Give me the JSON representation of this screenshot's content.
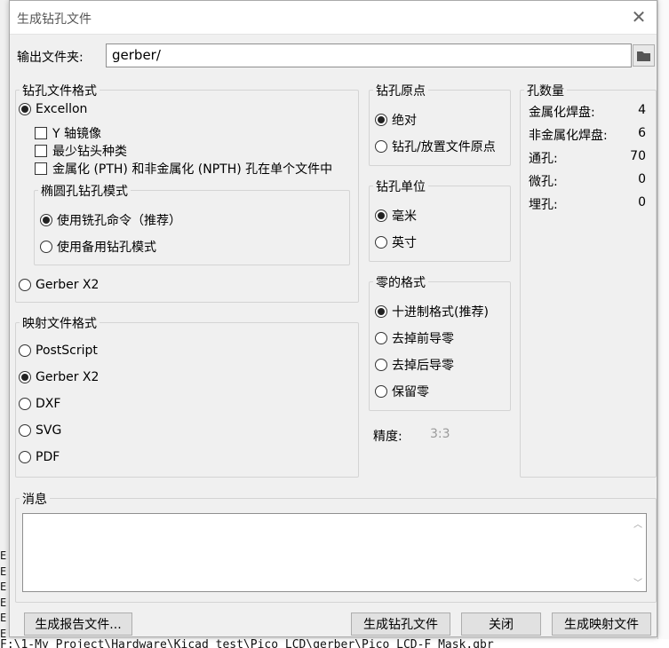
{
  "dialog": {
    "title": "生成钻孔文件",
    "output_folder_label": "输出文件夹:",
    "output_folder_value": "gerber/"
  },
  "drill_format": {
    "title": "钻孔文件格式",
    "excellon": "Excellon",
    "mirror_y": "Y 轴镜像",
    "minimal_header": "最少钻头种类",
    "merge_pth_npth": "金属化 (PTH) 和非金属化 (NPTH) 孔在单个文件中",
    "oval_title": "椭圆孔钻孔模式",
    "oval_route": "使用铣孔命令（推荐）",
    "oval_alt": "使用备用钻孔模式",
    "gerber_x2": "Gerber X2"
  },
  "map_format": {
    "title": "映射文件格式",
    "options": [
      "PostScript",
      "Gerber X2",
      "DXF",
      "SVG",
      "PDF"
    ],
    "selected_index": 1
  },
  "drill_origin": {
    "title": "钻孔原点",
    "absolute": "绝对",
    "aux": "钻孔/放置文件原点"
  },
  "drill_units": {
    "title": "钻孔单位",
    "mm": "毫米",
    "inch": "英寸"
  },
  "zeros": {
    "title": "零的格式",
    "options": [
      "十进制格式(推荐)",
      "去掉前导零",
      "去掉后导零",
      "保留零"
    ],
    "selected_index": 0
  },
  "precision": {
    "label": "精度:",
    "value": "3:3"
  },
  "hole_counts": {
    "title": "孔数量",
    "rows": [
      {
        "label": "金属化焊盘:",
        "value": "4"
      },
      {
        "label": "非金属化焊盘:",
        "value": "6"
      },
      {
        "label": "通孔:",
        "value": "70"
      },
      {
        "label": "微孔:",
        "value": "0"
      },
      {
        "label": "埋孔:",
        "value": "0"
      }
    ]
  },
  "messages": {
    "title": "消息"
  },
  "buttons": {
    "report": "生成报告文件...",
    "generate_drill": "生成钻孔文件",
    "close": "关闭",
    "generate_map": "生成映射文件"
  },
  "background": {
    "console_text": "F:\\1-My Project\\Hardware\\Kicad test\\Pico LCD\\gerber\\Pico_LCD-F_Mask.gbr"
  },
  "icons": {
    "close": "close-icon",
    "folder": "folder-icon"
  }
}
